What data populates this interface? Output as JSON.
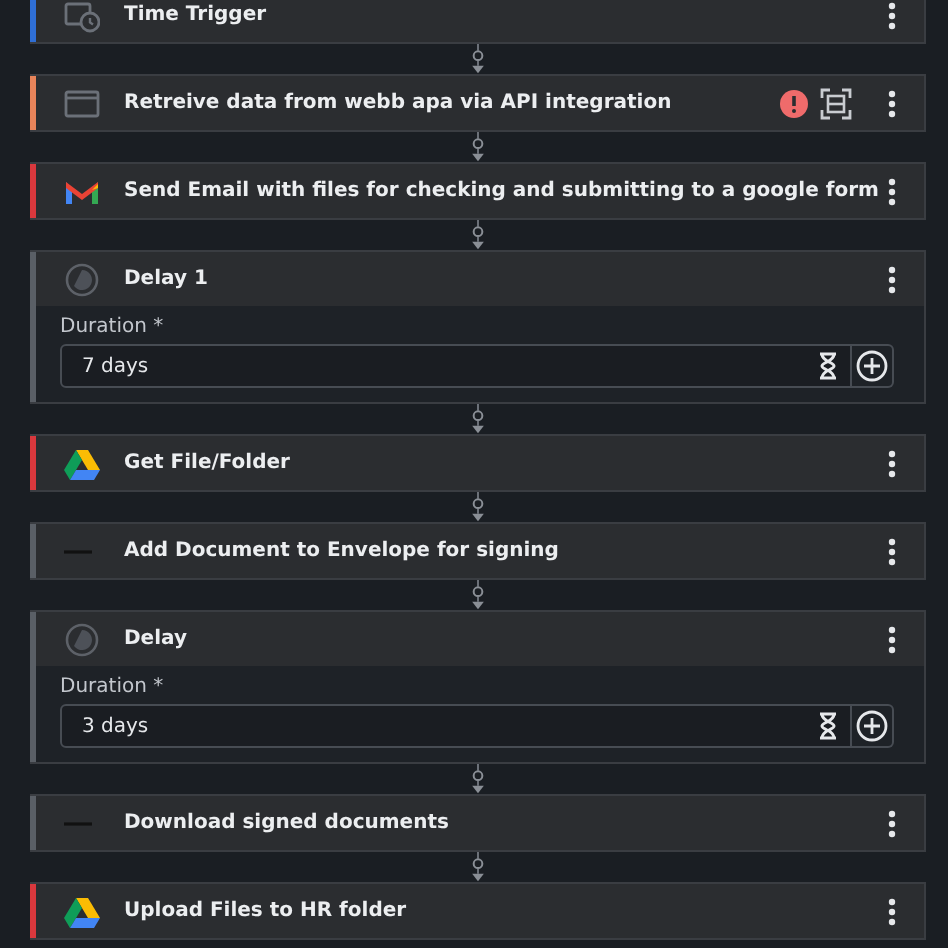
{
  "steps": [
    {
      "kind": "trigger",
      "title": "Time Trigger",
      "color": "#2f6fd6",
      "error": false
    },
    {
      "kind": "webhook",
      "title": "Retreive data from webb apa via API integration",
      "color": "#e8845a",
      "error": true
    },
    {
      "kind": "gmail",
      "title": "Send Email with files for checking and submitting to a google form",
      "color": "#d9383d",
      "error": false
    },
    {
      "kind": "delay",
      "title": "Delay 1",
      "color": "#5a5f66",
      "error": false,
      "field": {
        "label": "Duration *",
        "value": "7 days"
      }
    },
    {
      "kind": "drive",
      "title": "Get File/Folder",
      "color": "#d9383d",
      "error": false
    },
    {
      "kind": "document",
      "title": "Add Document to Envelope for signing",
      "color": "#5a5f66",
      "error": false
    },
    {
      "kind": "delay",
      "title": "Delay",
      "color": "#5a5f66",
      "error": false,
      "field": {
        "label": "Duration *",
        "value": "3 days"
      }
    },
    {
      "kind": "document",
      "title": "Download signed documents",
      "color": "#5a5f66",
      "error": false
    },
    {
      "kind": "drive",
      "title": "Upload Files to HR folder",
      "color": "#d9383d",
      "error": false
    }
  ]
}
